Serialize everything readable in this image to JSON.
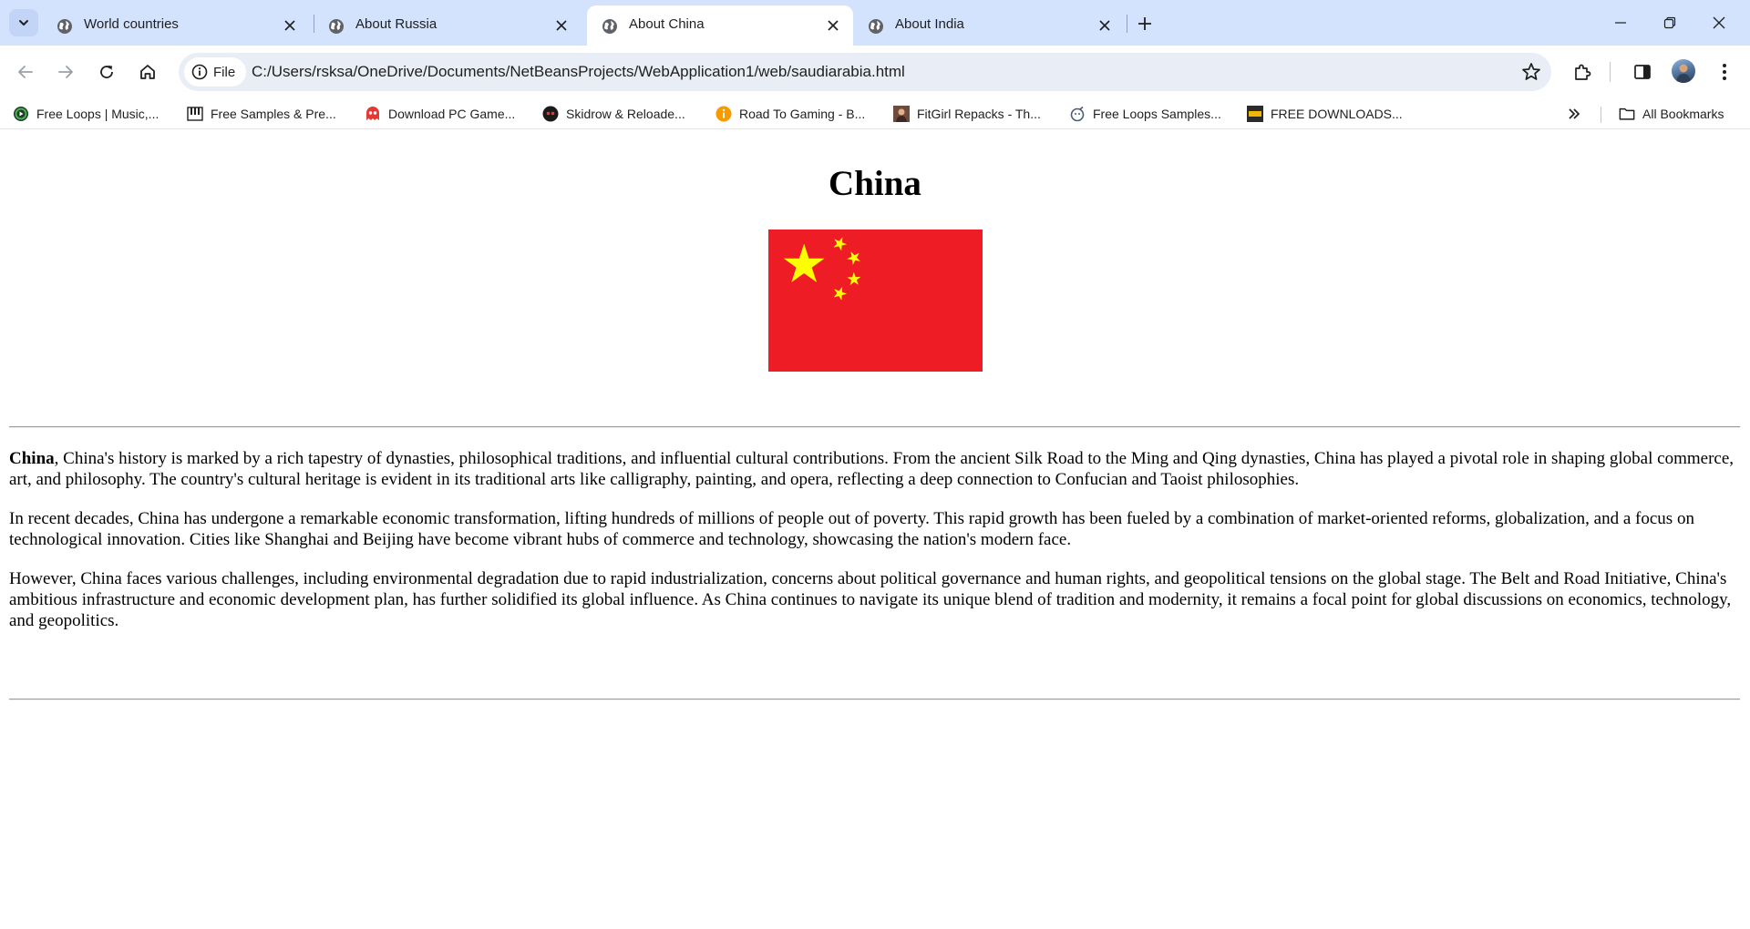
{
  "tabs": [
    {
      "title": "World countries",
      "active": false
    },
    {
      "title": "About Russia",
      "active": false
    },
    {
      "title": "About China",
      "active": true
    },
    {
      "title": "About India",
      "active": false
    }
  ],
  "address_bar": {
    "scheme_chip": "File",
    "url": "C:/Users/rsksa/OneDrive/Documents/NetBeansProjects/WebApplication1/web/saudiarabia.html"
  },
  "bookmarks": [
    {
      "label": "Free Loops | Music,...",
      "icon": "free-loops-icon"
    },
    {
      "label": "Free Samples & Pre...",
      "icon": "piano-icon"
    },
    {
      "label": "Download PC Game...",
      "icon": "ghost-icon"
    },
    {
      "label": "Skidrow & Reloade...",
      "icon": "skull-icon"
    },
    {
      "label": "Road To Gaming - B...",
      "icon": "info-orange-icon"
    },
    {
      "label": "FitGirl Repacks - Th...",
      "icon": "fitgirl-icon"
    },
    {
      "label": "Free Loops Samples...",
      "icon": "bomb-icon"
    },
    {
      "label": "FREE DOWNLOADS...",
      "icon": "flp-icon"
    }
  ],
  "all_bookmarks_label": "All Bookmarks",
  "page": {
    "title": "China",
    "flag_colors": {
      "field": "#ee1c25",
      "stars": "#ffff00"
    },
    "p1_bold": "China",
    "p1_rest": ", China's history is marked by a rich tapestry of dynasties, philosophical traditions, and influential cultural contributions. From the ancient Silk Road to the Ming and Qing dynasties, China has played a pivotal role in shaping global commerce, art, and philosophy. The country's cultural heritage is evident in its traditional arts like calligraphy, painting, and opera, reflecting a deep connection to Confucian and Taoist philosophies.",
    "p2": "In recent decades, China has undergone a remarkable economic transformation, lifting hundreds of millions of people out of poverty. This rapid growth has been fueled by a combination of market-oriented reforms, globalization, and a focus on technological innovation. Cities like Shanghai and Beijing have become vibrant hubs of commerce and technology, showcasing the nation's modern face.",
    "p3": "However, China faces various challenges, including environmental degradation due to rapid industrialization, concerns about political governance and human rights, and geopolitical tensions on the global stage. The Belt and Road Initiative, China's ambitious infrastructure and economic development plan, has further solidified its global influence. As China continues to navigate its unique blend of tradition and modernity, it remains a focal point for global discussions on economics, technology, and geopolitics."
  }
}
